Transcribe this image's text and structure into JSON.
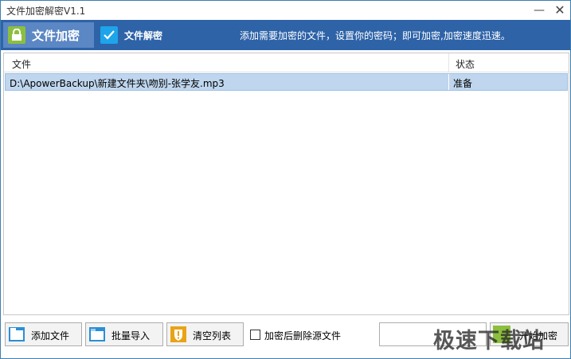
{
  "window": {
    "title": "文件加密解密V1.1"
  },
  "header": {
    "tab_encrypt": "文件加密",
    "tab_decrypt": "文件解密",
    "hint": "添加需要加密的文件，设置你的密码；即可加密,加密速度迅速。"
  },
  "table": {
    "columns": [
      "文件",
      "状态"
    ],
    "rows": [
      {
        "file": "D:\\ApowerBackup\\新建文件夹\\吻别-张学友.mp3",
        "status": "准备"
      }
    ]
  },
  "toolbar": {
    "add_file": "添加文件",
    "batch_import": "批量导入",
    "clear_list": "清空列表",
    "delete_source_label": "加密后删除源文件",
    "delete_source_checked": false,
    "password_value": "",
    "start_encrypt": "开始加密"
  },
  "watermark": {
    "text": "极速下载站"
  },
  "colors": {
    "header_bg": "#2e63a8",
    "active_tab_bg": "#5b87c4",
    "lock_green": "#8cbf3f",
    "check_blue": "#1ea4ea",
    "selected_row": "#bfd6ee"
  }
}
